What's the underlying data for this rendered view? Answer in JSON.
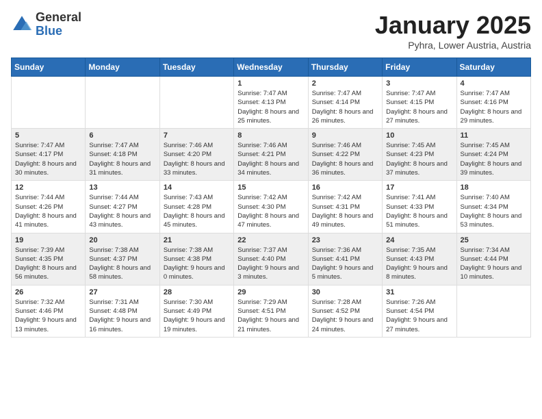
{
  "logo": {
    "general": "General",
    "blue": "Blue"
  },
  "title": "January 2025",
  "location": "Pyhra, Lower Austria, Austria",
  "days_of_week": [
    "Sunday",
    "Monday",
    "Tuesday",
    "Wednesday",
    "Thursday",
    "Friday",
    "Saturday"
  ],
  "weeks": [
    [
      {
        "day": "",
        "info": ""
      },
      {
        "day": "",
        "info": ""
      },
      {
        "day": "",
        "info": ""
      },
      {
        "day": "1",
        "info": "Sunrise: 7:47 AM\nSunset: 4:13 PM\nDaylight: 8 hours and 25 minutes."
      },
      {
        "day": "2",
        "info": "Sunrise: 7:47 AM\nSunset: 4:14 PM\nDaylight: 8 hours and 26 minutes."
      },
      {
        "day": "3",
        "info": "Sunrise: 7:47 AM\nSunset: 4:15 PM\nDaylight: 8 hours and 27 minutes."
      },
      {
        "day": "4",
        "info": "Sunrise: 7:47 AM\nSunset: 4:16 PM\nDaylight: 8 hours and 29 minutes."
      }
    ],
    [
      {
        "day": "5",
        "info": "Sunrise: 7:47 AM\nSunset: 4:17 PM\nDaylight: 8 hours and 30 minutes."
      },
      {
        "day": "6",
        "info": "Sunrise: 7:47 AM\nSunset: 4:18 PM\nDaylight: 8 hours and 31 minutes."
      },
      {
        "day": "7",
        "info": "Sunrise: 7:46 AM\nSunset: 4:20 PM\nDaylight: 8 hours and 33 minutes."
      },
      {
        "day": "8",
        "info": "Sunrise: 7:46 AM\nSunset: 4:21 PM\nDaylight: 8 hours and 34 minutes."
      },
      {
        "day": "9",
        "info": "Sunrise: 7:46 AM\nSunset: 4:22 PM\nDaylight: 8 hours and 36 minutes."
      },
      {
        "day": "10",
        "info": "Sunrise: 7:45 AM\nSunset: 4:23 PM\nDaylight: 8 hours and 37 minutes."
      },
      {
        "day": "11",
        "info": "Sunrise: 7:45 AM\nSunset: 4:24 PM\nDaylight: 8 hours and 39 minutes."
      }
    ],
    [
      {
        "day": "12",
        "info": "Sunrise: 7:44 AM\nSunset: 4:26 PM\nDaylight: 8 hours and 41 minutes."
      },
      {
        "day": "13",
        "info": "Sunrise: 7:44 AM\nSunset: 4:27 PM\nDaylight: 8 hours and 43 minutes."
      },
      {
        "day": "14",
        "info": "Sunrise: 7:43 AM\nSunset: 4:28 PM\nDaylight: 8 hours and 45 minutes."
      },
      {
        "day": "15",
        "info": "Sunrise: 7:42 AM\nSunset: 4:30 PM\nDaylight: 8 hours and 47 minutes."
      },
      {
        "day": "16",
        "info": "Sunrise: 7:42 AM\nSunset: 4:31 PM\nDaylight: 8 hours and 49 minutes."
      },
      {
        "day": "17",
        "info": "Sunrise: 7:41 AM\nSunset: 4:33 PM\nDaylight: 8 hours and 51 minutes."
      },
      {
        "day": "18",
        "info": "Sunrise: 7:40 AM\nSunset: 4:34 PM\nDaylight: 8 hours and 53 minutes."
      }
    ],
    [
      {
        "day": "19",
        "info": "Sunrise: 7:39 AM\nSunset: 4:35 PM\nDaylight: 8 hours and 56 minutes."
      },
      {
        "day": "20",
        "info": "Sunrise: 7:38 AM\nSunset: 4:37 PM\nDaylight: 8 hours and 58 minutes."
      },
      {
        "day": "21",
        "info": "Sunrise: 7:38 AM\nSunset: 4:38 PM\nDaylight: 9 hours and 0 minutes."
      },
      {
        "day": "22",
        "info": "Sunrise: 7:37 AM\nSunset: 4:40 PM\nDaylight: 9 hours and 3 minutes."
      },
      {
        "day": "23",
        "info": "Sunrise: 7:36 AM\nSunset: 4:41 PM\nDaylight: 9 hours and 5 minutes."
      },
      {
        "day": "24",
        "info": "Sunrise: 7:35 AM\nSunset: 4:43 PM\nDaylight: 9 hours and 8 minutes."
      },
      {
        "day": "25",
        "info": "Sunrise: 7:34 AM\nSunset: 4:44 PM\nDaylight: 9 hours and 10 minutes."
      }
    ],
    [
      {
        "day": "26",
        "info": "Sunrise: 7:32 AM\nSunset: 4:46 PM\nDaylight: 9 hours and 13 minutes."
      },
      {
        "day": "27",
        "info": "Sunrise: 7:31 AM\nSunset: 4:48 PM\nDaylight: 9 hours and 16 minutes."
      },
      {
        "day": "28",
        "info": "Sunrise: 7:30 AM\nSunset: 4:49 PM\nDaylight: 9 hours and 19 minutes."
      },
      {
        "day": "29",
        "info": "Sunrise: 7:29 AM\nSunset: 4:51 PM\nDaylight: 9 hours and 21 minutes."
      },
      {
        "day": "30",
        "info": "Sunrise: 7:28 AM\nSunset: 4:52 PM\nDaylight: 9 hours and 24 minutes."
      },
      {
        "day": "31",
        "info": "Sunrise: 7:26 AM\nSunset: 4:54 PM\nDaylight: 9 hours and 27 minutes."
      },
      {
        "day": "",
        "info": ""
      }
    ]
  ]
}
